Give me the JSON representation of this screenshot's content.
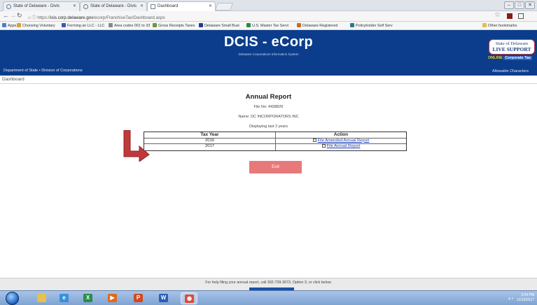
{
  "browser": {
    "tabs": [
      {
        "label": "State of Delaware - Divis"
      },
      {
        "label": "State of Delaware - Divis"
      },
      {
        "label": "Dashboard"
      }
    ],
    "url": {
      "scheme": "https://",
      "host": "icis.corp.delaware.gov",
      "path": "/ecorp/FranchiseTax/Dashboard.aspx"
    },
    "bookmarks": [
      {
        "label": "Apps",
        "icon": "apps-grid-icon",
        "color": "#4a7fd4"
      },
      {
        "label": "Choosing Voluntary",
        "icon": "folder-icon",
        "color": "#d8a23a"
      },
      {
        "label": "Forming an LLC - LLC",
        "icon": "page-icon",
        "color": "#3b5bab"
      },
      {
        "label": "Area codes 001 to 33",
        "icon": "page-icon",
        "color": "#888888"
      },
      {
        "label": "Gross Receipts Taxes",
        "icon": "page-icon",
        "color": "#6a9a3a"
      },
      {
        "label": "Delaware Small Busi",
        "icon": "page-icon",
        "color": "#1f3c88"
      },
      {
        "label": "U.S. Master Tax Servi",
        "icon": "page-icon",
        "color": "#2a8c3a"
      },
      {
        "label": "Delaware Registered",
        "icon": "page-icon",
        "color": "#d06a1a"
      },
      {
        "label": "Policyholder Self Serv",
        "icon": "page-icon",
        "color": "#2a7a8c"
      },
      {
        "label": "Other bookmarks",
        "icon": "folder-icon",
        "color": "#e2c04a"
      }
    ]
  },
  "header": {
    "title": "DCIS - eCorp",
    "subtitle": "Delaware Corporations Information System",
    "department": "Department of State • Division of Corporations",
    "live_support": {
      "line1": "State of Delaware",
      "line2": "LIVE SUPPORT"
    },
    "online_label": "ONLINE",
    "corporate_tax": "Corporate Tax",
    "allowable_characters": "Allowable Characters"
  },
  "breadcrumb": {
    "label": "Dashboard"
  },
  "report": {
    "title": "Annual Report",
    "file_no_label": "File No:",
    "file_no": "4438826",
    "name_label": "Name:",
    "name": "DC INCORPORATORS INC",
    "showing": "Displaying last 2 years"
  },
  "table": {
    "headers": [
      "Tax Year",
      "Action"
    ],
    "rows": [
      {
        "year": "2016",
        "action": "File Amended Annual Report"
      },
      {
        "year": "2017",
        "action": "File Annual Report"
      }
    ]
  },
  "exit_label": "Exit",
  "footer": {
    "text": "For help filing your annual report, call 302-739-3073, Option 3, or click below."
  },
  "taskbar": {
    "apps": [
      {
        "icon": "explorer-icon",
        "color": "#e8c04a"
      },
      {
        "icon": "ie-icon",
        "color": "#3a8fd8"
      },
      {
        "icon": "excel-icon",
        "color": "#2a8c4a"
      },
      {
        "icon": "media-icon",
        "color": "#e06a1a"
      },
      {
        "icon": "powerpoint-icon",
        "color": "#d0491f"
      },
      {
        "icon": "word-icon",
        "color": "#2b5cb8"
      },
      {
        "icon": "chrome-icon",
        "color": "#dd4b39"
      }
    ],
    "time": "3:04 PM",
    "date": "12/19/2017"
  },
  "colors": {
    "header_bg": "#0c3d8c",
    "exit_button": "#e8797a",
    "arrow": "#c0393b",
    "link": "#1a3bb8"
  }
}
